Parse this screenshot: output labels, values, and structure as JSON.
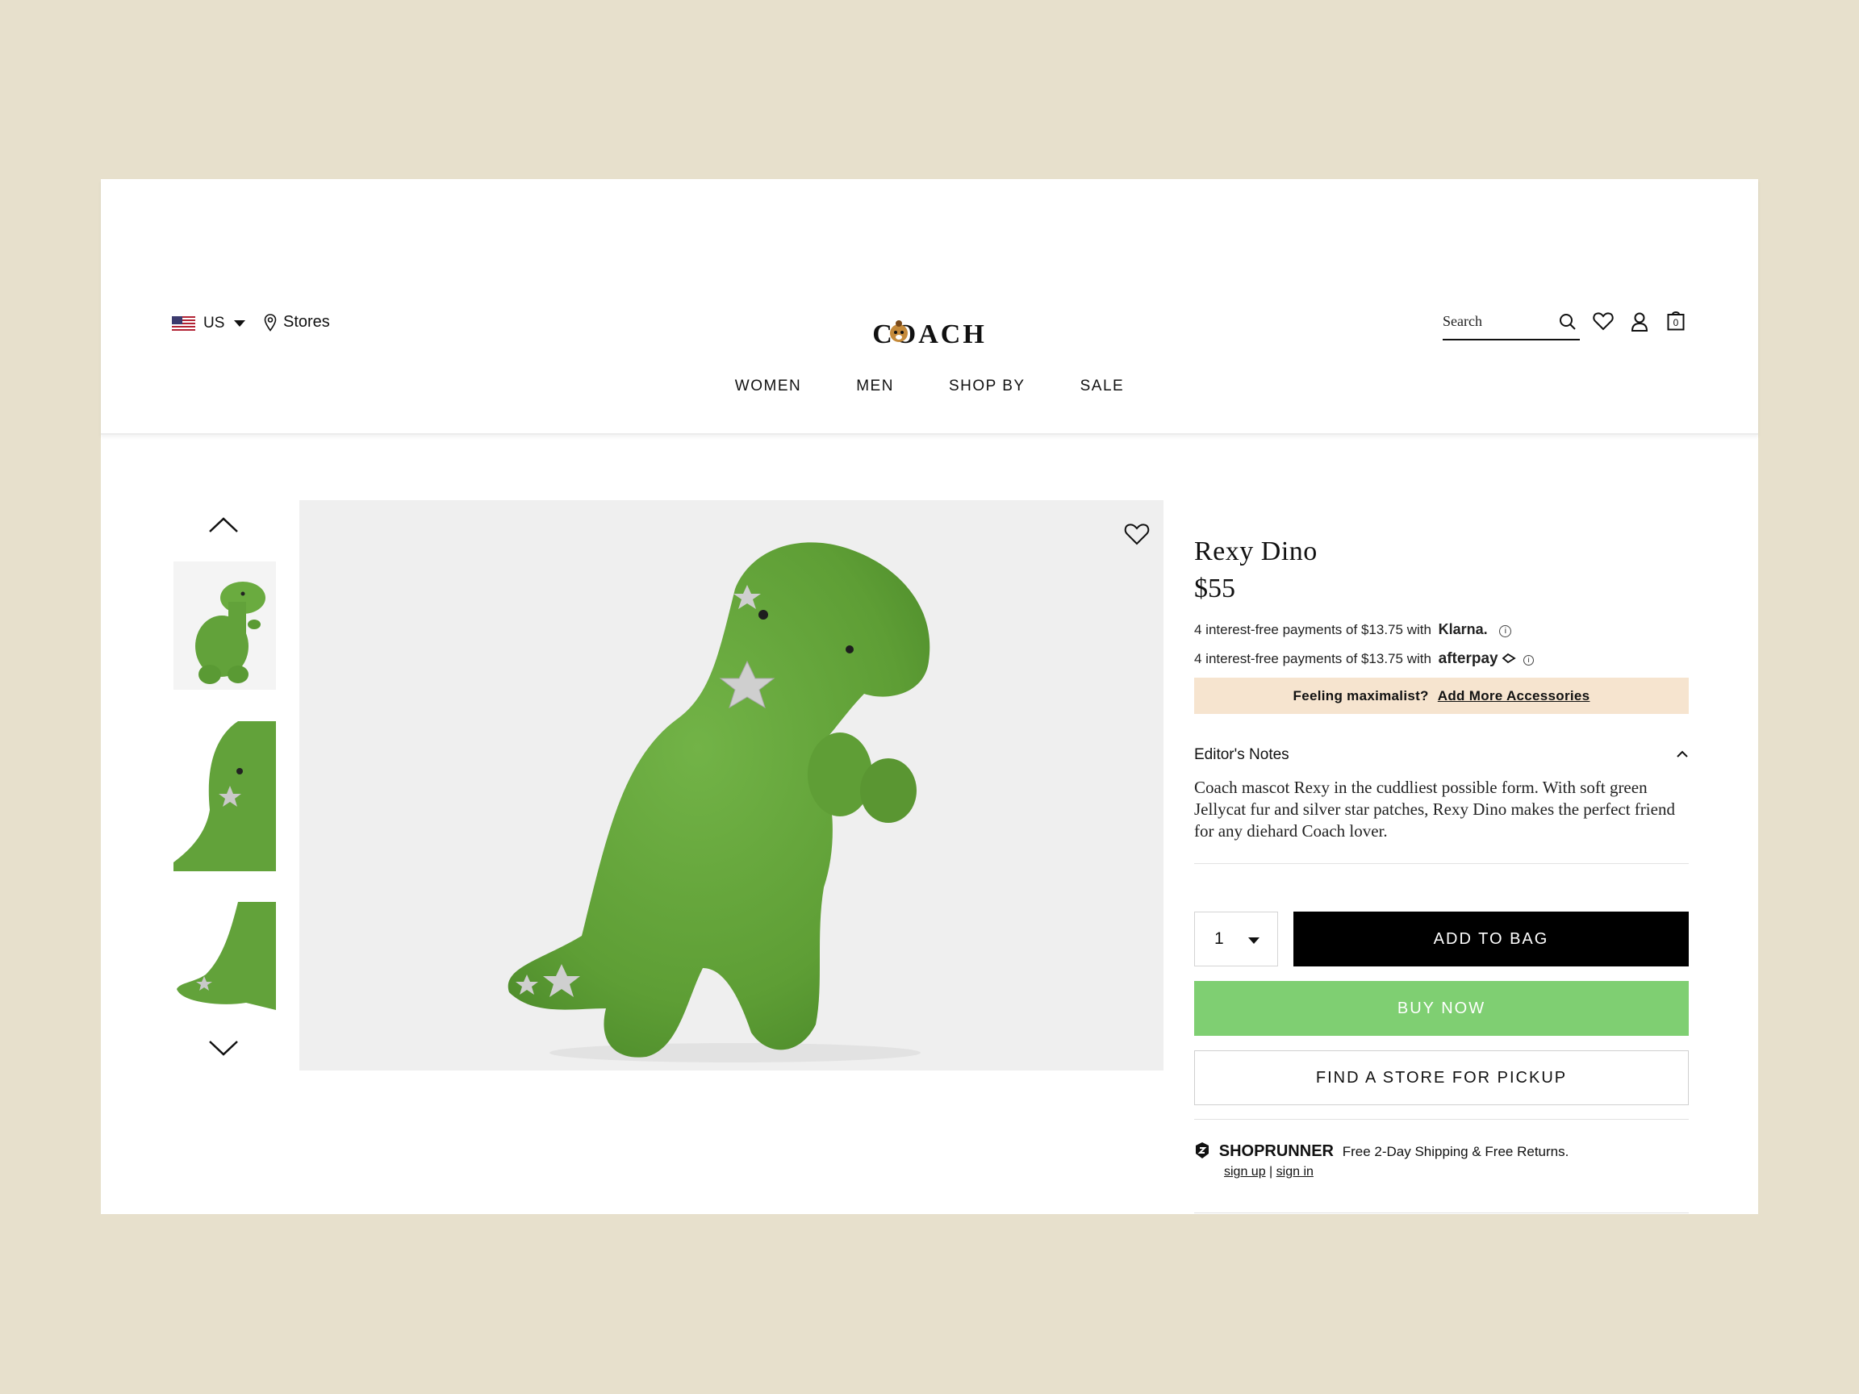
{
  "header": {
    "country": "US",
    "stores_label": "Stores",
    "logo_text": "COACH",
    "search_placeholder": "Search",
    "bag_count": "0"
  },
  "nav": [
    "WOMEN",
    "MEN",
    "SHOP BY",
    "SALE"
  ],
  "product": {
    "name": "Rexy Dino",
    "price": "$55",
    "klarna": {
      "text": "4 interest-free payments of",
      "amount": "$13.75",
      "with": "with",
      "brand": "Klarna."
    },
    "afterpay": {
      "text": "4 interest-free payments of",
      "amount": "$13.75",
      "with": "with",
      "brand": "afterpay"
    },
    "promo": {
      "text": "Feeling maximalist?",
      "link": "Add More Accessories"
    },
    "editors_notes_title": "Editor's Notes",
    "editors_notes_body": "Coach mascot Rexy in the cuddliest possible form. With soft green Jellycat fur and silver star patches, Rexy Dino makes the perfect friend for any diehard Coach lover.",
    "quantity": "1",
    "add_to_bag": "ADD TO BAG",
    "buy_now": "BUY NOW",
    "find_store": "FIND A STORE FOR PICKUP"
  },
  "shoprunner": {
    "name": "SHOPRUNNER",
    "tagline": "Free 2-Day Shipping & Free Returns.",
    "sign_up": "sign up",
    "separator": "|",
    "sign_in": "sign in"
  },
  "colors": {
    "page_bg": "#e7e0cc",
    "promo_bg": "#f6e4cf",
    "buy_now": "#7fcf72",
    "add_to_bag": "#000000",
    "dino_green": "#5f9e36"
  },
  "icons": [
    "us-flag-icon",
    "location-pin-icon",
    "search-icon",
    "heart-icon",
    "account-icon",
    "bag-icon",
    "chevron-up-icon",
    "chevron-down-icon",
    "shoprunner-icon",
    "info-icon"
  ]
}
